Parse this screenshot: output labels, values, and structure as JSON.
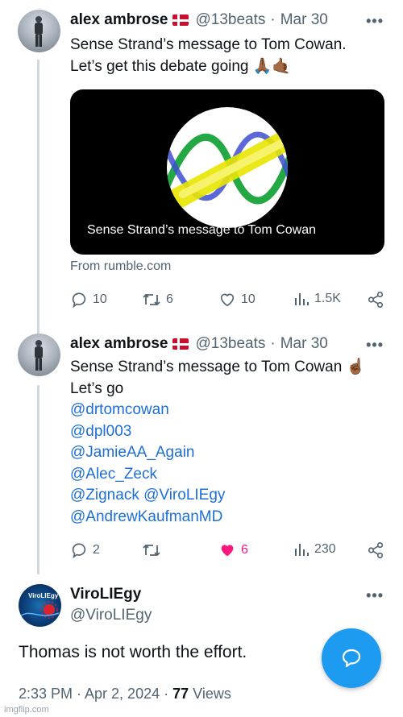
{
  "tweet1": {
    "name": "alex ambrose",
    "handle": "@13beats",
    "sep": "·",
    "date": "Mar 30",
    "more": "•••",
    "line1": "Sense Strand’s message to Tom Cowan.",
    "line2": "Let’s get this debate going 🙏🏾🤙🏾",
    "media_caption": "Sense Strand’s message to Tom Cowan",
    "from": "From rumble.com",
    "replies": "10",
    "retweets": "6",
    "likes": "10",
    "views": "1.5K"
  },
  "tweet2": {
    "name": "alex ambrose",
    "handle": "@13beats",
    "sep": "·",
    "date": "Mar 30",
    "more": "•••",
    "line1": "Sense Strand’s message to Tom Cowan ☝🏾",
    "line2": "Let’s go",
    "mentions": [
      "@drtomcowan",
      "@dpl003",
      "@JamieAA_Again",
      "@Alec_Zeck",
      "@Zignack @ViroLIEgy",
      "@AndrewKaufmanMD"
    ],
    "replies": "2",
    "retweets": "",
    "likes": "6",
    "views": "230"
  },
  "main": {
    "name": "ViroLIEgy",
    "handle": "@ViroLIEgy",
    "more": "•••",
    "avatar_text": "ViroLIEgy",
    "text": "Thomas is not worth the effort.",
    "time": "2:33 PM · Apr 2, 2024 · ",
    "views_count": "77",
    "views_label": " Views"
  },
  "watermark": "imgflip.com",
  "colors": {
    "accent": "#1d9bf0",
    "like_active": "#f91880",
    "mention": "#1d6fd8",
    "muted": "#536471"
  }
}
